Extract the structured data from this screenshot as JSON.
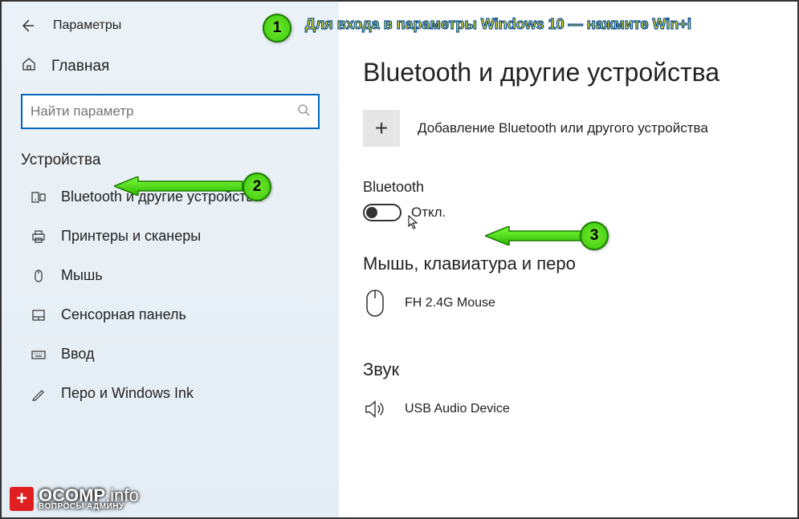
{
  "header": {
    "app_title": "Параметры"
  },
  "sidebar": {
    "home_label": "Главная",
    "search_placeholder": "Найти параметр",
    "category_label": "Устройства",
    "items": [
      {
        "label": "Bluetooth и другие устройства"
      },
      {
        "label": "Принтеры и сканеры"
      },
      {
        "label": "Мышь"
      },
      {
        "label": "Сенсорная панель"
      },
      {
        "label": "Ввод"
      },
      {
        "label": "Перо и Windows Ink"
      }
    ]
  },
  "main": {
    "page_title": "Bluetooth и другие устройства",
    "add_device_label": "Добавление Bluetooth или другого устройства",
    "bluetooth_section": "Bluetooth",
    "toggle_state": "Откл.",
    "mouse_section": "Мышь, клавиатура и перо",
    "mouse_device": "FH 2.4G Mouse",
    "sound_section": "Звук",
    "sound_device": "USB Audio Device"
  },
  "annotations": {
    "badge1": "1",
    "badge2": "2",
    "badge3": "3",
    "hint": "Для входа в параметры Windows 10 — нажмите Win+i"
  },
  "watermark": {
    "brand": "OCOMP",
    "tld": ".info",
    "sub": "ВОПРОСЫ АДМИНУ"
  }
}
